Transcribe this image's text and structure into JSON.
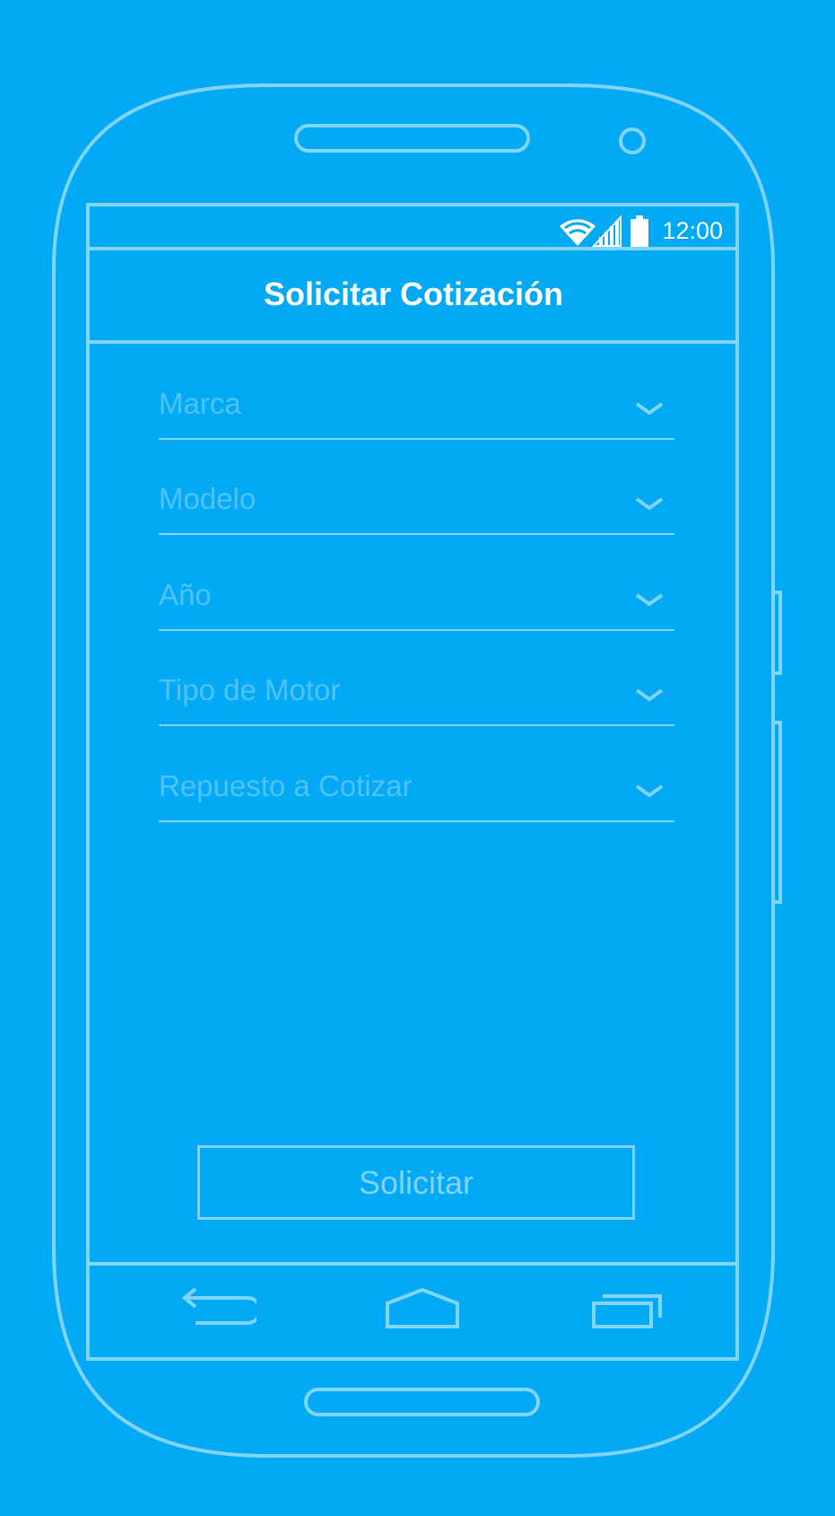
{
  "status_bar": {
    "time": "12:00",
    "icons": [
      "wifi-icon",
      "signal-icon",
      "battery-icon"
    ]
  },
  "header": {
    "title": "Solicitar Cotización"
  },
  "form": {
    "fields": [
      {
        "placeholder": "Marca",
        "icon": "chevron-down-icon"
      },
      {
        "placeholder": "Modelo",
        "icon": "chevron-down-icon"
      },
      {
        "placeholder": "Año",
        "icon": "chevron-down-icon"
      },
      {
        "placeholder": "Tipo de Motor",
        "icon": "chevron-down-icon"
      },
      {
        "placeholder": "Repuesto a Cotizar",
        "icon": "chevron-down-icon"
      }
    ],
    "submit_label": "Solicitar"
  },
  "nav_bar": {
    "icons": [
      "back-icon",
      "home-icon",
      "recents-icon"
    ]
  },
  "colors": {
    "background": "#03A9F4",
    "outline": "#81D4FA",
    "placeholder": "#4FC3F7",
    "text": "#FFFFFF"
  }
}
